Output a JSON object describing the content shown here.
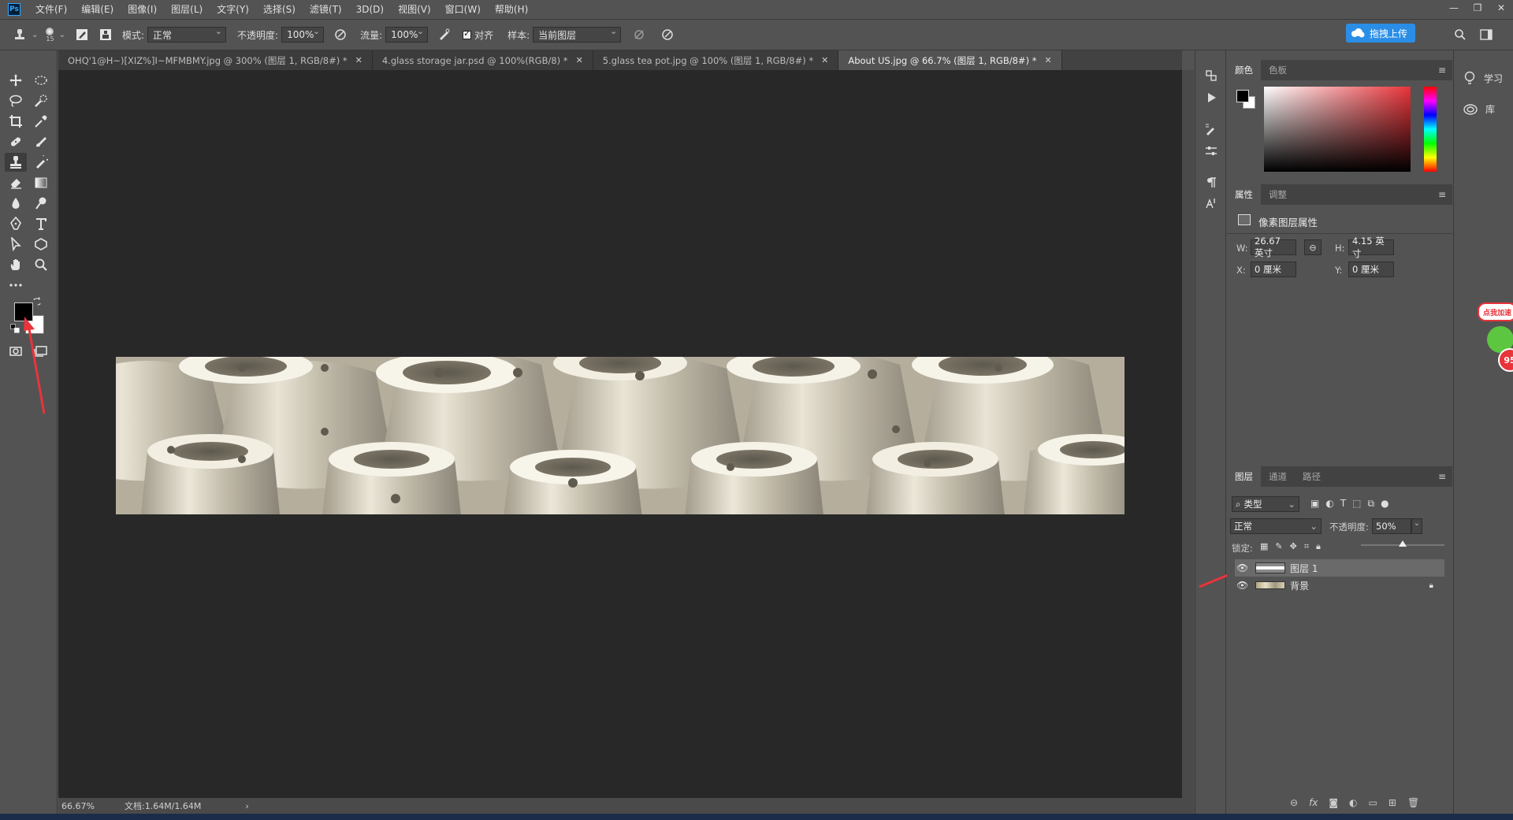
{
  "app": {
    "logo": "Ps"
  },
  "menu": [
    "文件(F)",
    "编辑(E)",
    "图像(I)",
    "图层(L)",
    "文字(Y)",
    "选择(S)",
    "滤镜(T)",
    "3D(D)",
    "视图(V)",
    "窗口(W)",
    "帮助(H)"
  ],
  "options": {
    "brush_size": "15",
    "mode_label": "模式:",
    "mode_value": "正常",
    "opacity_label": "不透明度:",
    "opacity_value": "100%",
    "flow_label": "流量:",
    "flow_value": "100%",
    "align_label": "对齐",
    "sample_label": "样本:",
    "sample_value": "当前图层",
    "upload_label": "拖拽上传"
  },
  "doc_tabs": [
    {
      "label": "OHQ'1@H~)[XIZ%]I~MFMBMY.jpg @ 300% (图层 1, RGB/8#) *",
      "active": false
    },
    {
      "label": "4.glass storage jar.psd @ 100%(RGB/8) *",
      "active": false
    },
    {
      "label": "5.glass tea pot.jpg @ 100% (图层 1, RGB/8#) *",
      "active": false
    },
    {
      "label": "About US.jpg @ 66.7% (图层 1, RGB/8#) *",
      "active": true
    }
  ],
  "status": {
    "zoom": "66.67%",
    "doc": "文档:1.64M/1.64M"
  },
  "color_panel": {
    "tabs": [
      "颜色",
      "色板"
    ],
    "accent": "#e8343a"
  },
  "properties_panel": {
    "tabs": [
      "属性",
      "调整"
    ],
    "title": "像素图层属性",
    "w_label": "W:",
    "w_value": "26.67 英寸",
    "h_label": "H:",
    "h_value": "4.15 英寸",
    "x_label": "X:",
    "x_value": "0 厘米",
    "y_label": "Y:",
    "y_value": "0 厘米"
  },
  "layers_panel": {
    "tabs": [
      "图层",
      "通道",
      "路径"
    ],
    "filter_label": "类型",
    "blend_mode": "正常",
    "opacity_label": "不透明度:",
    "opacity_value": "50%",
    "lock_label": "锁定:",
    "layers": [
      {
        "name": "图层 1",
        "visible": true,
        "active": true,
        "locked": false
      },
      {
        "name": "背景",
        "visible": true,
        "active": false,
        "locked": true
      }
    ]
  },
  "learn_panel": {
    "items": [
      "学习",
      "库"
    ]
  },
  "annotation": {
    "badge_text": "点我加速",
    "badge_number": "95"
  }
}
